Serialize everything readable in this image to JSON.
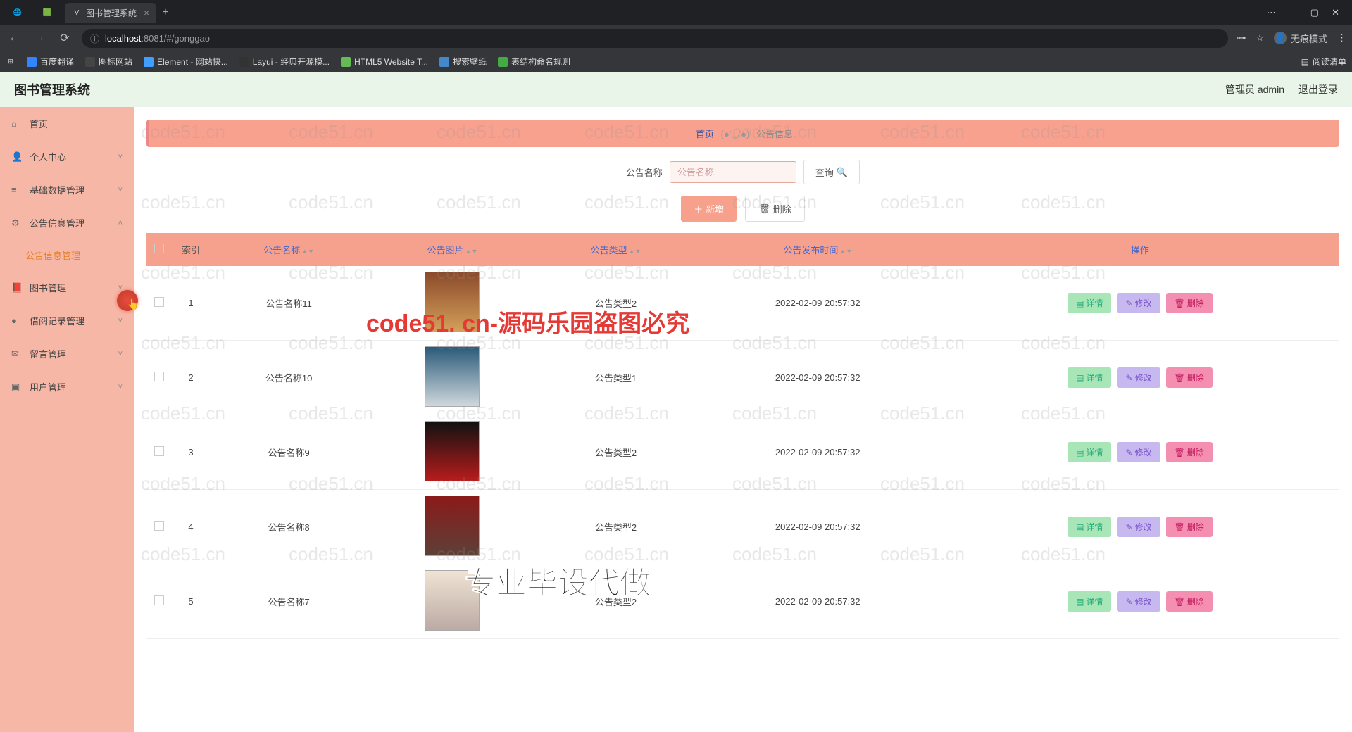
{
  "browser": {
    "tabs": [
      {
        "title": "",
        "favicon": "🌐"
      },
      {
        "title": "",
        "favicon": "🟩"
      },
      {
        "title": "图书管理系统",
        "favicon": "V",
        "active": true
      }
    ],
    "url_host": "localhost",
    "url_port": ":8081",
    "url_path": "/#/gonggao",
    "incognito_label": "无痕模式",
    "reading_list": "阅读清单",
    "bookmarks": [
      {
        "label": "百度翻译",
        "color": "#3385ff"
      },
      {
        "label": "图标网站",
        "color": "#444"
      },
      {
        "label": "Element - 网站快...",
        "color": "#409eff"
      },
      {
        "label": "Layui - 经典开源模...",
        "color": "#333"
      },
      {
        "label": "HTML5 Website T...",
        "color": "#6b5"
      },
      {
        "label": "搜索壁纸",
        "color": "#48c"
      },
      {
        "label": "表结构命名规则",
        "color": "#4a4"
      }
    ]
  },
  "app": {
    "title": "图书管理系统",
    "admin_label": "管理员 admin",
    "logout_label": "退出登录"
  },
  "sidebar": {
    "items": [
      {
        "label": "首页",
        "icon": "home",
        "expandable": false
      },
      {
        "label": "个人中心",
        "icon": "user",
        "expandable": true
      },
      {
        "label": "基础数据管理",
        "icon": "list",
        "expandable": true
      },
      {
        "label": "公告信息管理",
        "icon": "bell",
        "expandable": true,
        "expanded": true,
        "children": [
          {
            "label": "公告信息管理",
            "active": true
          }
        ]
      },
      {
        "label": "图书管理",
        "icon": "book",
        "expandable": true
      },
      {
        "label": "借阅记录管理",
        "icon": "dot",
        "expandable": true
      },
      {
        "label": "留言管理",
        "icon": "msg",
        "expandable": true
      },
      {
        "label": "用户管理",
        "icon": "users",
        "expandable": true
      }
    ]
  },
  "breadcrumb": {
    "home": "首页",
    "emoticon": "(●'◡'●)",
    "current": "公告信息"
  },
  "search": {
    "label": "公告名称",
    "placeholder": "公告名称",
    "query_btn": "查询"
  },
  "actions": {
    "add": "新增",
    "delete": "删除"
  },
  "table": {
    "headers": {
      "index": "索引",
      "name": "公告名称",
      "image": "公告图片",
      "type": "公告类型",
      "time": "公告发布时间",
      "ops": "操作"
    },
    "row_buttons": {
      "detail": "详情",
      "edit": "修改",
      "delete": "删除"
    },
    "rows": [
      {
        "index": "1",
        "name": "公告名称11",
        "type": "公告类型2",
        "time": "2022-02-09 20:57:32",
        "thumb": "c1"
      },
      {
        "index": "2",
        "name": "公告名称10",
        "type": "公告类型1",
        "time": "2022-02-09 20:57:32",
        "thumb": "c2"
      },
      {
        "index": "3",
        "name": "公告名称9",
        "type": "公告类型2",
        "time": "2022-02-09 20:57:32",
        "thumb": "c3"
      },
      {
        "index": "4",
        "name": "公告名称8",
        "type": "公告类型2",
        "time": "2022-02-09 20:57:32",
        "thumb": "c4"
      },
      {
        "index": "5",
        "name": "公告名称7",
        "type": "公告类型2",
        "time": "2022-02-09 20:57:32",
        "thumb": "c5"
      }
    ]
  },
  "watermarks": {
    "grey": "code51.cn",
    "red": "code51. cn-源码乐园盗图必究",
    "black": "专业毕设代做"
  }
}
